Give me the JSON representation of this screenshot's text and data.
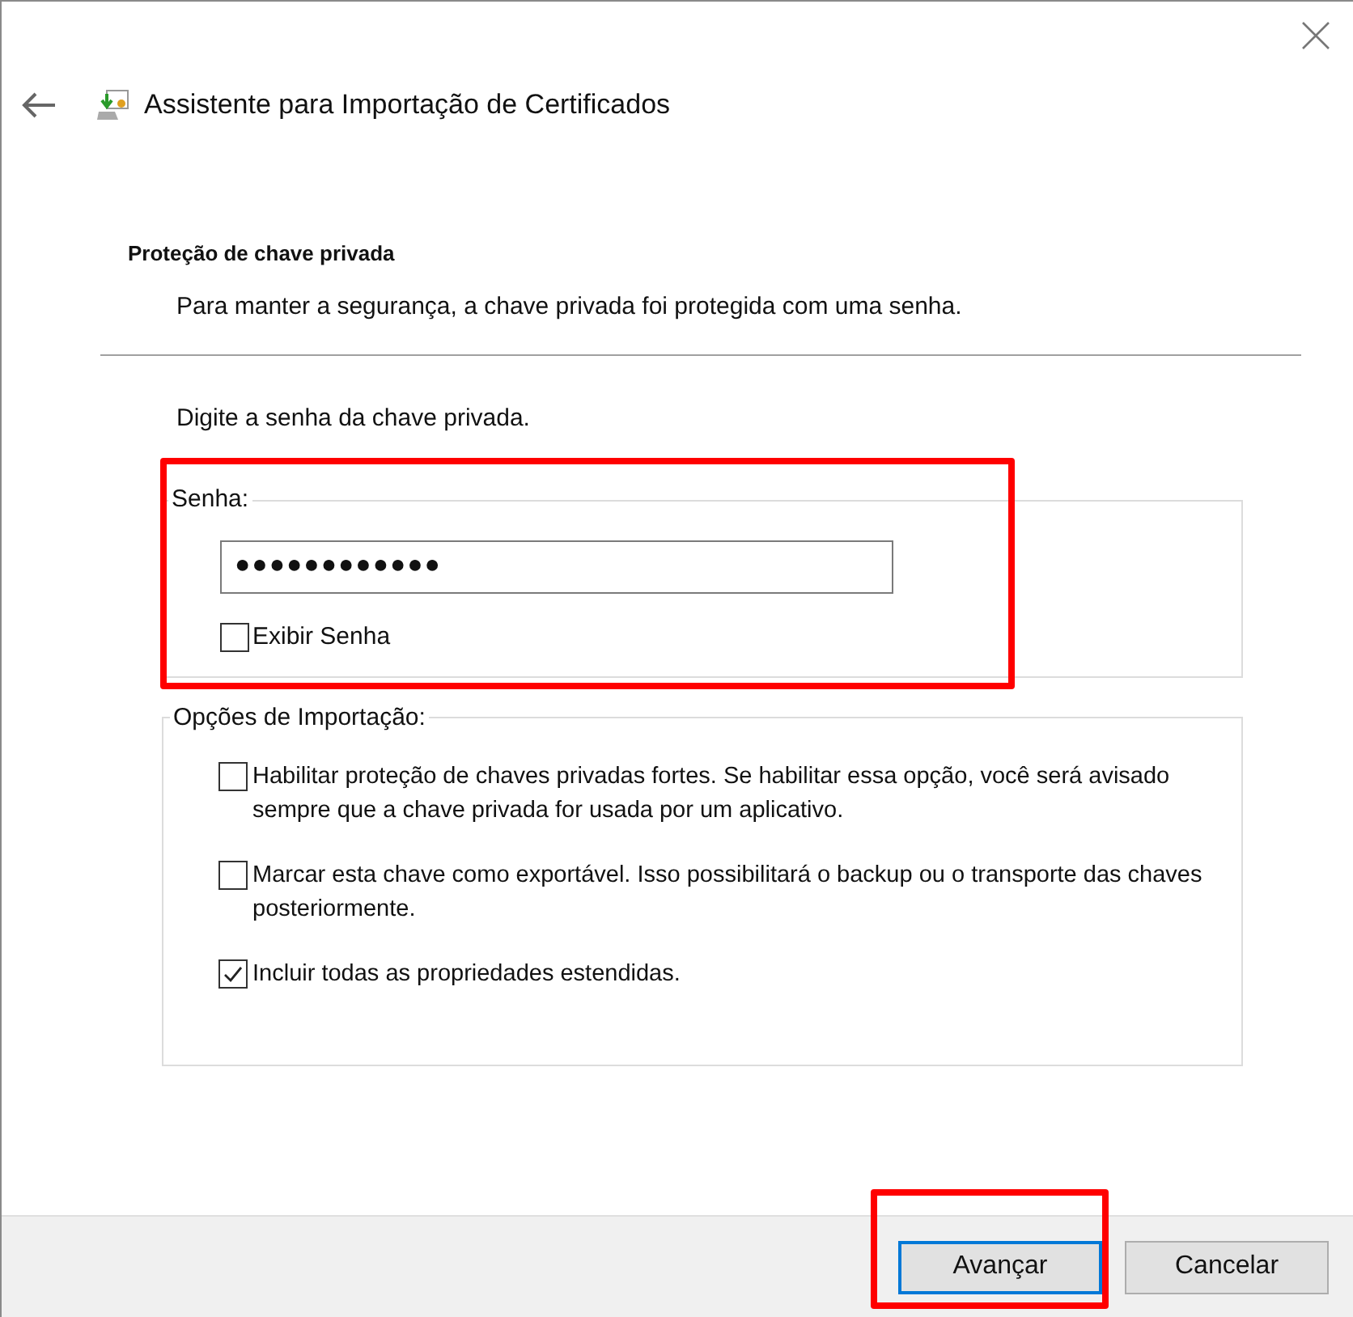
{
  "window": {
    "title": "Assistente para Importação de Certificados"
  },
  "section": {
    "title": "Proteção de chave privada",
    "description": "Para manter a segurança, a chave privada foi protegida com uma senha."
  },
  "prompt": "Digite a senha da chave privada.",
  "password_group": {
    "legend": "Senha:",
    "value": "●●●●●●●●●●●●",
    "highlighted": true,
    "show_password": {
      "label": "Exibir Senha",
      "checked": false
    }
  },
  "options_group": {
    "legend": "Opções de Importação:",
    "options": [
      {
        "label": "Habilitar proteção de chaves privadas fortes. Se habilitar essa opção, você será avisado sempre que a chave privada for usada por um aplicativo.",
        "checked": false
      },
      {
        "label": "Marcar esta chave como exportável. Isso possibilitará o backup ou o transporte das chaves posteriormente.",
        "checked": false
      },
      {
        "label": "Incluir todas as propriedades estendidas.",
        "checked": true
      }
    ]
  },
  "buttons": [
    {
      "label": "Avançar",
      "default": true,
      "highlighted": true
    },
    {
      "label": "Cancelar",
      "default": false,
      "highlighted": false
    }
  ]
}
